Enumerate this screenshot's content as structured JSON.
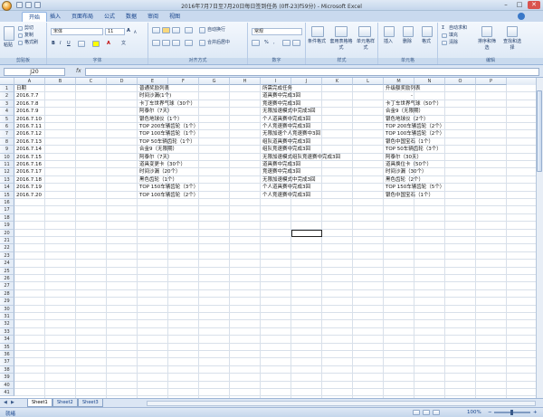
{
  "window": {
    "title": "2016年7月7日至7月20日每日签到任务 (0ff-23)f59分) - Microsoft Excel",
    "min": "–",
    "max": "□",
    "close": "✕"
  },
  "tabs": [
    "开始",
    "插入",
    "页面布局",
    "公式",
    "数据",
    "审阅",
    "视图"
  ],
  "ribbon": {
    "clipboard": {
      "paste": "粘贴",
      "cut": "剪切",
      "copy": "复制",
      "painter": "格式刷",
      "label": "剪贴板"
    },
    "font": {
      "name": "宋体",
      "size": "11",
      "label": "字体",
      "bold": "B",
      "italic": "I",
      "underline": "U",
      "grow": "A",
      "shrink": "A",
      "color": "A",
      "wen": "文"
    },
    "align": {
      "wrap": "自动换行",
      "merge": "合并后居中",
      "label": "对齐方式"
    },
    "number": {
      "format": "常规",
      "percent": "%",
      "comma": ",",
      "label": "数字"
    },
    "styles": {
      "cond": "条件格式",
      "table": "套用表格格式",
      "cell": "单元格样式",
      "label": "样式"
    },
    "cells": {
      "insert": "插入",
      "delete": "删除",
      "format": "格式",
      "label": "单元格"
    },
    "editing": {
      "sum": "自动求和",
      "fill": "填充",
      "clear": "清除",
      "sort": "排序和筛选",
      "find": "查找和选择",
      "label": "编辑"
    }
  },
  "formula": {
    "namebox": "J20",
    "fx": "fx",
    "value": ""
  },
  "columns": [
    "A",
    "B",
    "C",
    "D",
    "E",
    "F",
    "G",
    "H",
    "I",
    "J",
    "K",
    "L",
    "M",
    "N",
    "O",
    "P"
  ],
  "rows": [
    "1",
    "2",
    "3",
    "4",
    "5",
    "6",
    "7",
    "8",
    "9",
    "10",
    "11",
    "12",
    "13",
    "14",
    "15",
    "16",
    "17",
    "18",
    "19",
    "20",
    "21",
    "22",
    "23",
    "24",
    "25",
    "26",
    "27",
    "28",
    "29",
    "30",
    "31",
    "32",
    "33",
    "34",
    "35",
    "36",
    "37",
    "38",
    "39",
    "40",
    "41"
  ],
  "table": {
    "headers": [
      "日期",
      "普通奖励列表",
      "所需完成任务",
      "升级额奖励列表"
    ],
    "rows": [
      [
        "2016.7.7",
        "时间沙漏(1个)",
        "道具赛中完成3回",
        "-"
      ],
      [
        "2016.7.8",
        "卡丁车世界气球（30个）",
        "竞速赛中完成3回",
        "卡丁车世界气球（50个）"
      ],
      [
        "2016.7.9",
        "阿泰尔（7天）",
        "无限加速模式中完成3回",
        "合金9（无限期）"
      ],
      [
        "2016.7.10",
        "银色地球仪（1个）",
        "个人道具赛中完成3回",
        "银色地球仪（2个）"
      ],
      [
        "2016.7.11",
        "TOP 200车辆齿轮（1个）",
        "个人竞速赛中完成3回",
        "TOP 200车辆齿轮（2个）"
      ],
      [
        "2016.7.12",
        "TOP 100车辆齿轮（1个）",
        "无限加速个人竞速赛中3回",
        "TOP 100车辆齿轮（2个）"
      ],
      [
        "2016.7.13",
        "TOP 50车辆齿轮（1个）",
        "组队道具赛中完成3回",
        "银色中国宝石（1个）"
      ],
      [
        "2016.7.14",
        "合金9（无限期）",
        "组队竞速赛中完成3回",
        "TOP 50车辆齿轮（3个）"
      ],
      [
        "2016.7.15",
        "阿泰尔（7天）",
        "无限加速模式组队竞速赛中完成3回",
        "阿泰尔（30天）"
      ],
      [
        "2016.7.16",
        "道具变更卡（30个）",
        "道具赛中完成3回",
        "道具换位卡（50个）"
      ],
      [
        "2016.7.17",
        "时间沙漏（20个）",
        "竞速赛中完成3回",
        "时间沙漏（30个）"
      ],
      [
        "2016.7.18",
        "黑色齿轮（1个）",
        "无限加速模式中完成3回",
        "黑色齿轮（2个）"
      ],
      [
        "2016.7.19",
        "TOP 150车辆齿轮（3个）",
        "个人道具赛中完成3回",
        "TOP 150车辆齿轮（5个）"
      ],
      [
        "2016.7.20",
        "TOP 100车辆齿轮（2个）",
        "个人竞速赛中完成3回",
        "银色中国宝石（1个）"
      ]
    ]
  },
  "sheets": [
    "Sheet1",
    "Sheet2",
    "Sheet3"
  ],
  "status": {
    "ready": "就绪",
    "zoom": "100%",
    "minus": "−",
    "plus": "+"
  }
}
